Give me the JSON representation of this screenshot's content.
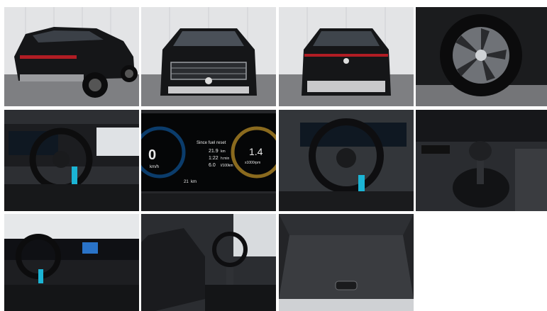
{
  "gallery": {
    "dash": {
      "speed": "0",
      "speed_unit": "km/h",
      "trip_title": "Since fuel reset",
      "trip_distance": "21.9",
      "trip_distance_unit": "km",
      "trip_time": "1:22",
      "trip_time_unit": "h:min",
      "trip_avg": "6.0",
      "trip_avg_unit": "l/100km",
      "rpm": "1.4",
      "rpm_unit": "x1000rpm",
      "odo": "21",
      "odo_unit": "km"
    }
  }
}
